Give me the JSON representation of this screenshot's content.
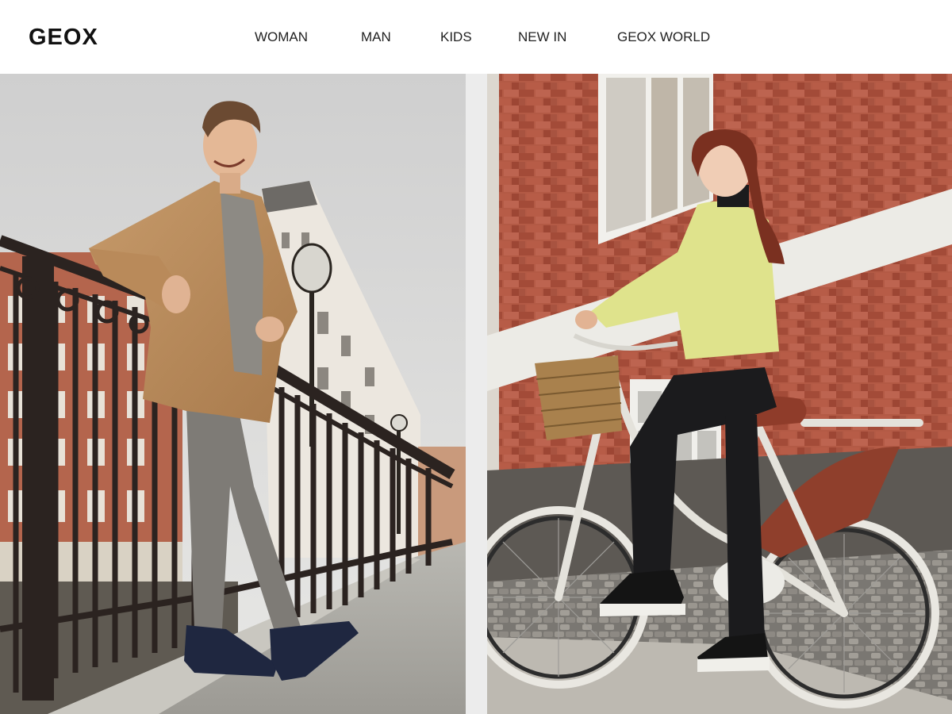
{
  "brand": {
    "logo_text": "GEOX"
  },
  "nav": {
    "items": [
      {
        "label": "WOMAN"
      },
      {
        "label": "MAN"
      },
      {
        "label": "KIDS"
      },
      {
        "label": "NEW IN"
      },
      {
        "label": "GEOX WORLD"
      }
    ]
  },
  "hero": {
    "left_image": "man-on-bridge-photo",
    "right_image": "woman-on-bicycle-photo"
  },
  "colors": {
    "brick": "#b5503e",
    "sky": "#dcdcdc",
    "coat": "#c09060",
    "sweater": "#dfe28a"
  }
}
